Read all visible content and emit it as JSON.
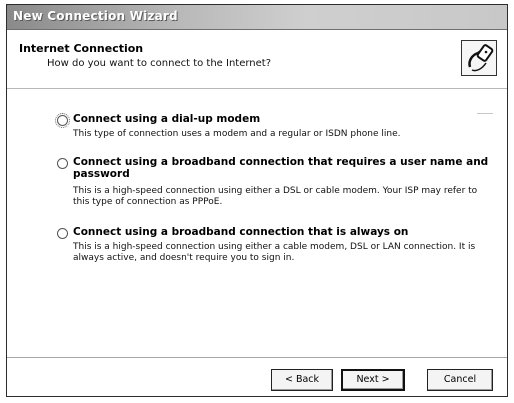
{
  "window": {
    "title": "New Connection Wizard"
  },
  "header": {
    "heading": "Internet Connection",
    "subheading": "How do you want to connect to the Internet?",
    "icon": "network-cable-icon"
  },
  "options": [
    {
      "label": "Connect using a dial-up modem",
      "description": "This type of connection uses a modem and a regular or ISDN phone line.",
      "selected": false
    },
    {
      "label": "Connect using a broadband connection that requires a user name and password",
      "description": "This is a high-speed connection using either a DSL or cable modem. Your ISP may refer to this type of connection as PPPoE.",
      "selected": false
    },
    {
      "label": "Connect using a broadband connection that is always on",
      "description": "This is a high-speed connection using either a cable modem, DSL or LAN connection. It is always active, and doesn't require you to sign in.",
      "selected": false
    }
  ],
  "buttons": {
    "back": "< Back",
    "next": "Next >",
    "cancel": "Cancel"
  }
}
